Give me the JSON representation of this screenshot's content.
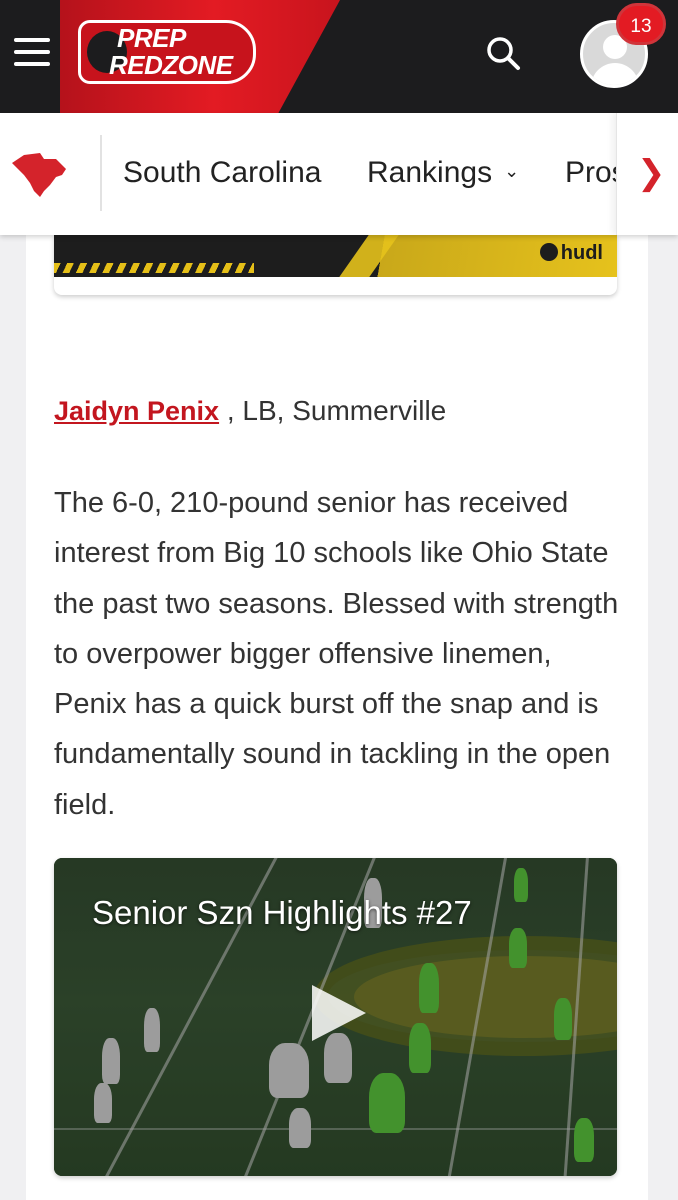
{
  "header": {
    "logo_line1": "PREP",
    "logo_line2": "REDZONE",
    "notification_count": "13",
    "accent_color": "#e31b23"
  },
  "state_nav": {
    "state": "South Carolina",
    "items": [
      {
        "label": "South Carolina"
      },
      {
        "label": "Rankings"
      },
      {
        "label": "Pros"
      }
    ]
  },
  "video_top": {
    "brand": "hudl"
  },
  "article": {
    "player_name": "Jaidyn Penix",
    "player_details": " , LB, Summerville",
    "paragraph": "The 6-0, 210-pound senior has received interest from Big 10 schools like Ohio State the past two seasons. Blessed with strength to overpower bigger offensive linemen, Penix has a quick burst off the snap and is fundamentally sound in tackling in the open field."
  },
  "video": {
    "title": "Senior Szn Highlights #27"
  }
}
